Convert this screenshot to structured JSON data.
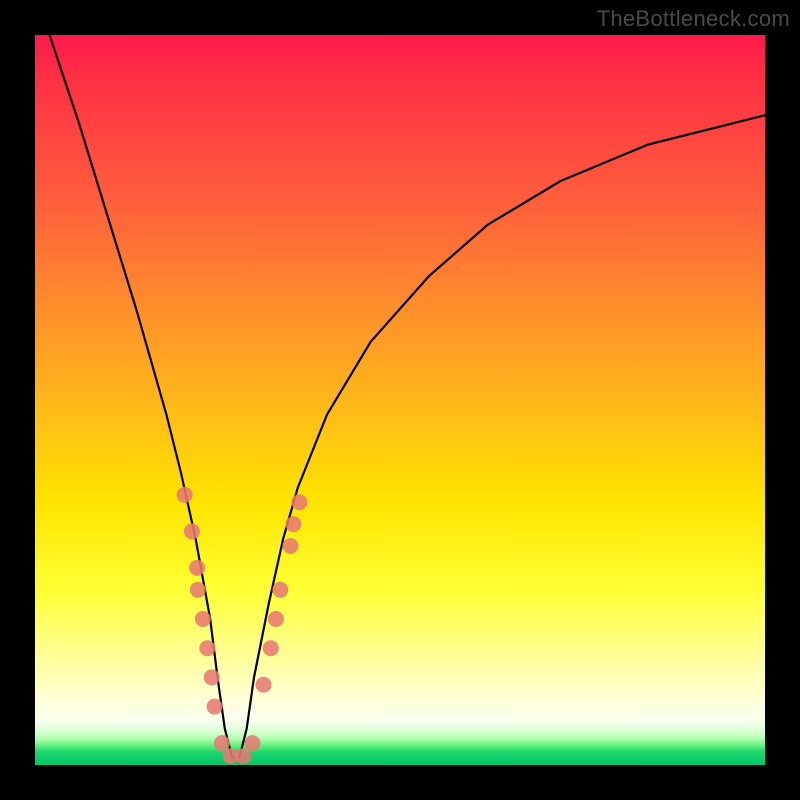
{
  "watermark": "TheBottleneck.com",
  "colors": {
    "frame": "#000000",
    "curve": "#000000",
    "markers": "#e77a73",
    "gradient_stops": [
      "#ff1a4d",
      "#ff5c3d",
      "#ffb71a",
      "#ffe400",
      "#ffffa1",
      "#00c86a"
    ]
  },
  "chart_data": {
    "type": "line",
    "title": "",
    "xlabel": "",
    "ylabel": "",
    "xlim": [
      0,
      100
    ],
    "ylim": [
      0,
      100
    ],
    "notes": "Background color encodes bottleneck severity (red high, green low). Curve is a V shape with minimum near x≈27. Left branch steep, right branch shallow. Markers cluster on both branches near the bottom.",
    "series": [
      {
        "name": "bottleneck-curve",
        "x": [
          2,
          6,
          10,
          14,
          18,
          20,
          22,
          24,
          25,
          26,
          27,
          28,
          29,
          30,
          32,
          34,
          36,
          40,
          46,
          54,
          62,
          72,
          84,
          96,
          100
        ],
        "y": [
          100,
          88,
          75,
          62,
          48,
          40,
          31,
          20,
          12,
          5,
          1,
          1,
          5,
          12,
          22,
          31,
          38,
          48,
          58,
          67,
          74,
          80,
          85,
          88,
          89
        ]
      }
    ],
    "markers": [
      {
        "x": 20.5,
        "y": 37
      },
      {
        "x": 21.5,
        "y": 32
      },
      {
        "x": 22.2,
        "y": 27
      },
      {
        "x": 22.3,
        "y": 24
      },
      {
        "x": 23.0,
        "y": 20
      },
      {
        "x": 23.6,
        "y": 16
      },
      {
        "x": 24.2,
        "y": 12
      },
      {
        "x": 24.6,
        "y": 8
      },
      {
        "x": 25.6,
        "y": 3
      },
      {
        "x": 26.8,
        "y": 1.2
      },
      {
        "x": 28.5,
        "y": 1.2
      },
      {
        "x": 29.8,
        "y": 3
      },
      {
        "x": 31.3,
        "y": 11
      },
      {
        "x": 32.3,
        "y": 16
      },
      {
        "x": 33.0,
        "y": 20
      },
      {
        "x": 33.6,
        "y": 24
      },
      {
        "x": 35.0,
        "y": 30
      },
      {
        "x": 35.4,
        "y": 33
      },
      {
        "x": 36.2,
        "y": 36
      }
    ]
  }
}
